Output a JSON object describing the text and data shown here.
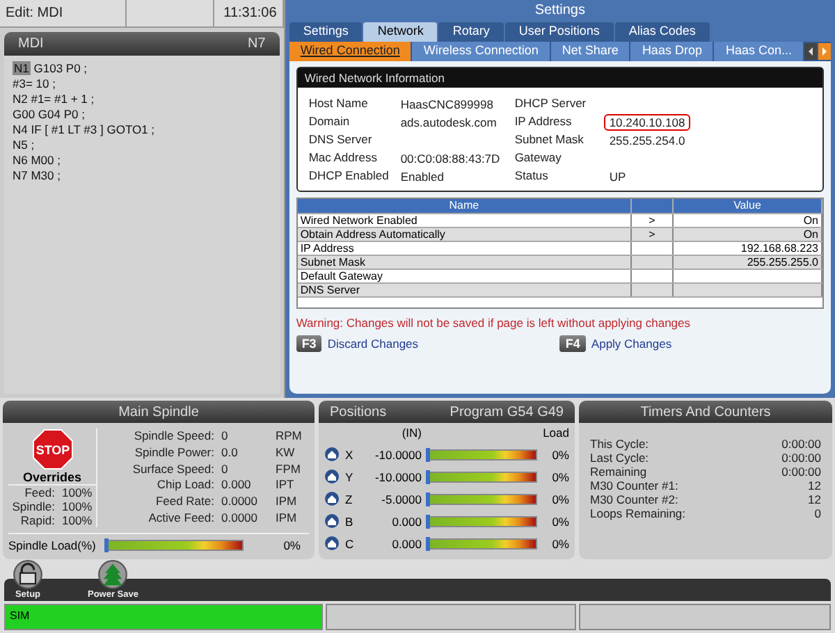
{
  "top_bar": {
    "mode": "Edit: MDI",
    "time": "11:31:06"
  },
  "program": {
    "title": "MDI",
    "block": "N7",
    "lines": [
      {
        "label": "N1",
        "selected": true,
        "text": "G103 P0 ;"
      },
      {
        "text": "#3= 10 ;"
      },
      {
        "text": "N2 #1= #1 + 1 ;"
      },
      {
        "text": "G00 G04 P0 ;"
      },
      {
        "text": "N4 IF [ #1 LT #3 ] GOTO1 ;"
      },
      {
        "text": "N5 ;"
      },
      {
        "text": "N6 M00 ;"
      },
      {
        "text": "N7 M30 ;"
      }
    ]
  },
  "settings": {
    "title": "Settings",
    "tabs": [
      {
        "label": "Settings",
        "selected": false
      },
      {
        "label": "Network",
        "selected": true
      },
      {
        "label": "Rotary",
        "selected": false
      },
      {
        "label": "User Positions",
        "selected": false
      },
      {
        "label": "Alias Codes",
        "selected": false
      }
    ],
    "subtabs": [
      {
        "label": "Wired Connection",
        "selected": true
      },
      {
        "label": "Wireless Connection",
        "selected": false
      },
      {
        "label": "Net Share",
        "selected": false
      },
      {
        "label": "Haas Drop",
        "selected": false
      },
      {
        "label": "Haas Con...",
        "selected": false
      }
    ],
    "info_title": "Wired Network Information",
    "info": [
      {
        "label": "Host Name",
        "value": "HaasCNC899998"
      },
      {
        "label": "DHCP Server"
      },
      {
        "label": "Domain",
        "value": "ads.autodesk.com"
      },
      {
        "label": "IP Address",
        "value": "10.240.10.108",
        "highlighted": true
      },
      {
        "label": "DNS Server"
      },
      {
        "label": "Subnet Mask",
        "value": "255.255.254.0"
      },
      {
        "label": "Mac Address",
        "value": "00:C0:08:88:43:7D"
      },
      {
        "label": "Gateway"
      },
      {
        "label": "DHCP Enabled",
        "value": "Enabled"
      },
      {
        "label": "Status",
        "value": "UP"
      }
    ],
    "table": {
      "columns": [
        "Name",
        "Value"
      ],
      "rows": [
        {
          "name": "Wired Network Enabled",
          "arrow": ">",
          "value": "On"
        },
        {
          "name": "Obtain Address Automatically",
          "arrow": ">",
          "value": "On"
        },
        {
          "name": "IP Address",
          "value": "192.168.68.223"
        },
        {
          "name": "Subnet Mask",
          "value": "255.255.255.0"
        },
        {
          "name": "Default Gateway"
        },
        {
          "name": "DNS Server"
        }
      ]
    },
    "warning": "Warning: Changes will not be saved if page is left without applying changes",
    "actions": [
      {
        "key": "F3",
        "label": "Discard Changes"
      },
      {
        "key": "F4",
        "label": "Apply Changes"
      }
    ]
  },
  "spindle": {
    "title": "Main Spindle",
    "stop": "STOP",
    "overrides_title": "Overrides",
    "overrides": [
      {
        "label": "Feed:",
        "value": "100%"
      },
      {
        "label": "Spindle:",
        "value": "100%"
      },
      {
        "label": "Rapid:",
        "value": "100%"
      }
    ],
    "readings": [
      {
        "label": "Spindle Speed:",
        "value": "0",
        "unit": "RPM"
      },
      {
        "label": "Spindle Power:",
        "value": "0.0",
        "unit": "KW"
      },
      {
        "label": "Surface Speed:",
        "value": "0",
        "unit": "FPM"
      },
      {
        "label": "Chip Load:",
        "value": "0.000",
        "unit": "IPT"
      },
      {
        "label": "Feed Rate:",
        "value": "0.0000",
        "unit": "IPM"
      },
      {
        "label": "Active Feed:",
        "value": "0.0000",
        "unit": "IPM"
      }
    ],
    "load_label": "Spindle Load(%)",
    "load": {
      "level": 0,
      "reading": "0%"
    }
  },
  "positions": {
    "title": "Positions",
    "program": "Program G54 G49",
    "units": "(IN)",
    "load_heading": "Load",
    "axes": [
      {
        "axis": "X",
        "value": "-10.0000",
        "level": 0,
        "load": "0%"
      },
      {
        "axis": "Y",
        "value": "-10.0000",
        "level": 0,
        "load": "0%"
      },
      {
        "axis": "Z",
        "value": "-5.0000",
        "level": 0,
        "load": "0%"
      },
      {
        "axis": "B",
        "value": "0.000",
        "level": 0,
        "load": "0%"
      },
      {
        "axis": "C",
        "value": "0.000",
        "level": 0,
        "load": "0%"
      }
    ]
  },
  "timers": {
    "title": "Timers And Counters",
    "items": [
      {
        "label": "This Cycle:",
        "value": "0:00:00"
      },
      {
        "label": "Last Cycle:",
        "value": "0:00:00"
      },
      {
        "label": "Remaining",
        "value": "0:00:00"
      },
      {
        "label": "M30 Counter #1:",
        "value": "12"
      },
      {
        "label": "M30 Counter #2:",
        "value": "12"
      },
      {
        "label": "Loops Remaining:",
        "value": "0"
      }
    ]
  },
  "toolbar": [
    {
      "kind": "lock",
      "label": "Setup"
    },
    {
      "kind": "tree",
      "label": "Power Save"
    }
  ],
  "status_bar": {
    "mode": "SIM"
  }
}
